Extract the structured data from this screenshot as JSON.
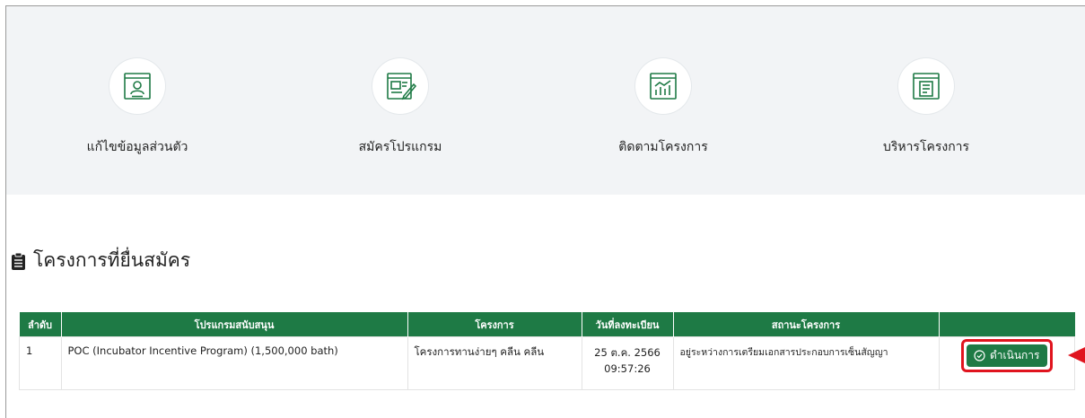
{
  "menu": [
    {
      "label": "แก้ไขข้อมูลส่วนตัว",
      "icon": "profile-icon"
    },
    {
      "label": "สมัครโปรแกรม",
      "icon": "application-form-icon"
    },
    {
      "label": "ติดตามโครงการ",
      "icon": "tracking-chart-icon"
    },
    {
      "label": "บริหารโครงการ",
      "icon": "project-document-icon"
    }
  ],
  "section": {
    "title": "โครงการที่ยื่นสมัคร",
    "icon": "clipboard-icon"
  },
  "table": {
    "headers": [
      "ลำดับ",
      "โปรแกรมสนับสนุน",
      "โครงการ",
      "วันที่ลงทะเบียน",
      "สถานะโครงการ",
      ""
    ],
    "rows": [
      {
        "no": "1",
        "program": "POC (Incubator Incentive Program) (1,500,000 bath)",
        "project": "โครงการทานง่ายๆ คลีน คลีน",
        "date": "25 ต.ค. 2566",
        "time": "09:57:26",
        "status": "อยู่ระหว่างการเตรียมเอกสารประกอบการเซ็นสัญญา",
        "action": "ดำเนินการ"
      }
    ]
  },
  "colors": {
    "primary": "#1e7a45",
    "highlight": "#e0141e",
    "band": "#f2f4f6"
  }
}
